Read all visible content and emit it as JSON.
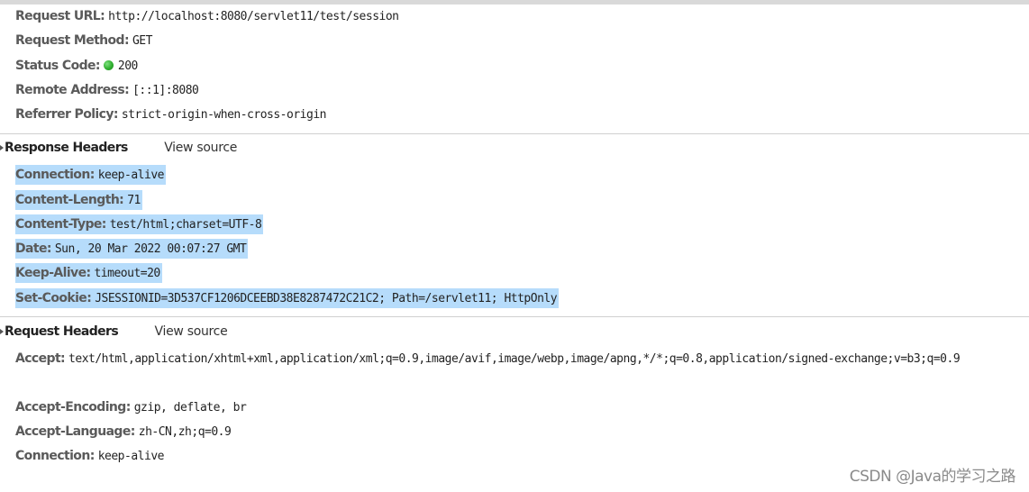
{
  "general": {
    "request_url": {
      "key": "Request URL:",
      "value": "http://localhost:8080/servlet11/test/session"
    },
    "request_method": {
      "key": "Request Method:",
      "value": "GET"
    },
    "status_code": {
      "key": "Status Code:",
      "value": "200",
      "status_color": "#2fae2f"
    },
    "remote_address": {
      "key": "Remote Address:",
      "value": "[::1]:8080"
    },
    "referrer_policy": {
      "key": "Referrer Policy:",
      "value": "strict-origin-when-cross-origin"
    }
  },
  "response_headers": {
    "title": "Response Headers",
    "view_source": "View source",
    "highlight_color": "#b6dcfb",
    "items": [
      {
        "key": "Connection:",
        "value": "keep-alive"
      },
      {
        "key": "Content-Length:",
        "value": "71"
      },
      {
        "key": "Content-Type:",
        "value": "test/html;charset=UTF-8"
      },
      {
        "key": "Date:",
        "value": "Sun, 20 Mar 2022 00:07:27 GMT"
      },
      {
        "key": "Keep-Alive:",
        "value": "timeout=20"
      },
      {
        "key": "Set-Cookie:",
        "value": "JSESSIONID=3D537CF1206DCEEBD38E8287472C21C2; Path=/servlet11; HttpOnly"
      }
    ]
  },
  "request_headers": {
    "title": "Request Headers",
    "view_source": "View source",
    "items": [
      {
        "key": "Accept:",
        "value": "text/html,application/xhtml+xml,application/xml;q=0.9,image/avif,image/webp,image/apng,*/*;q=0.8,application/signed-exchange;v=b3;q=0.9"
      },
      {
        "key": "Accept-Encoding:",
        "value": "gzip, deflate, br"
      },
      {
        "key": "Accept-Language:",
        "value": "zh-CN,zh;q=0.9"
      },
      {
        "key": "Connection:",
        "value": "keep-alive"
      }
    ]
  },
  "watermark": "CSDN @Java的学习之路"
}
